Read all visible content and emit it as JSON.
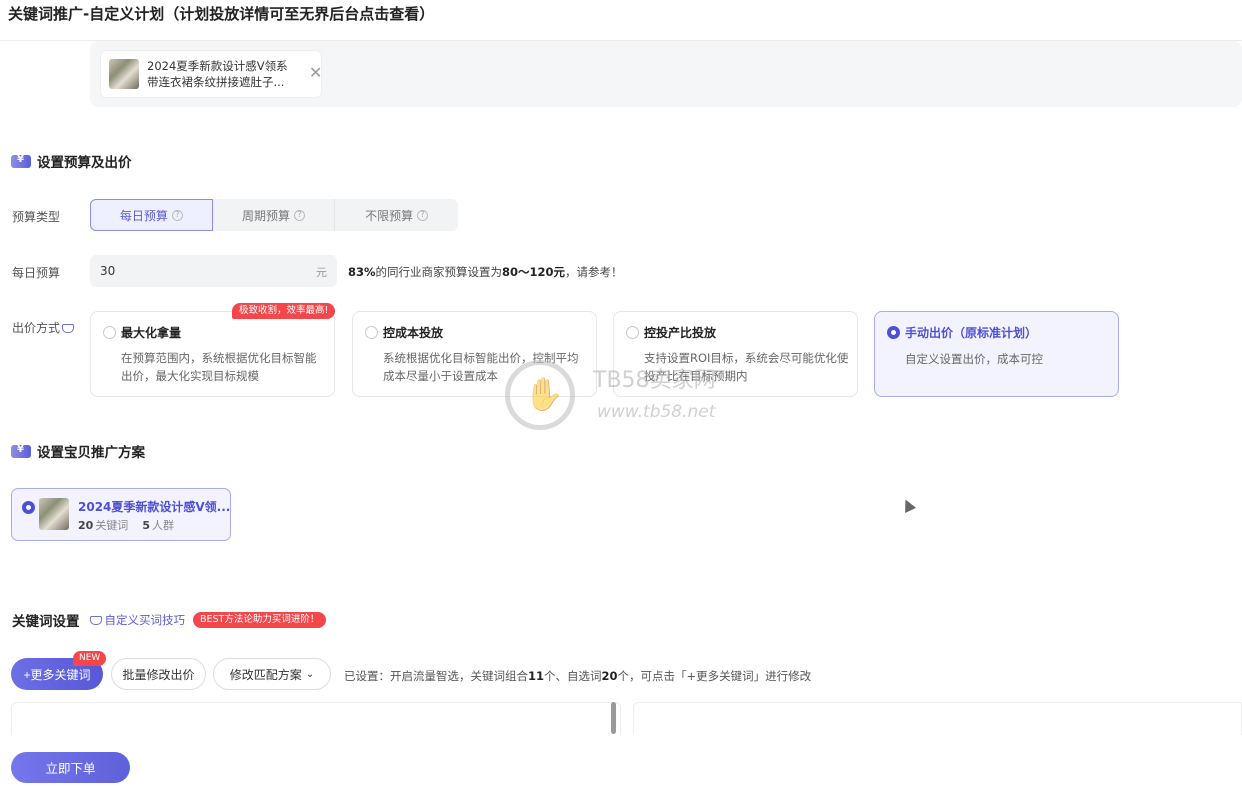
{
  "page": {
    "title": "关键词推广-自定义计划（计划投放详情可至无界后台点击查看）"
  },
  "selected_product": {
    "name": "2024夏季新款设计感V领系带连衣裙条纹拼接遮肚子...",
    "close_glyph": "✕"
  },
  "budget_section": {
    "heading": "设置预算及出价",
    "budget_type_label": "预算类型",
    "budget_types": [
      {
        "label": "每日预算",
        "active": true
      },
      {
        "label": "周期预算",
        "active": false
      },
      {
        "label": "不限预算",
        "active": false
      }
    ],
    "daily_budget_label": "每日预算",
    "daily_budget_value": "30",
    "daily_budget_unit": "元",
    "tip_percent": "83%",
    "tip_mid": "的同行业商家预算设置为",
    "tip_range": "80～120元",
    "tip_end": "，请参考！",
    "bid_method_label": "出价方式",
    "hot_badge": "极致收割，效率最高!",
    "bid_options": [
      {
        "title": "最大化拿量",
        "desc": "在预算范围内，系统根据优化目标智能出价，最大化实现目标规模",
        "active": false
      },
      {
        "title": "控成本投放",
        "desc": "系统根据优化目标智能出价，控制平均成本尽量小于设置成本",
        "active": false
      },
      {
        "title": "控投产比投放",
        "desc": "支持设置ROI目标，系统会尽可能优化使投产比在目标预期内",
        "active": false
      },
      {
        "title": "手动出价（原标准计划）",
        "desc": "自定义设置出价，成本可控",
        "active": true
      }
    ]
  },
  "plan_section": {
    "heading": "设置宝贝推广方案",
    "plan": {
      "name": "2024夏季新款设计感V领...",
      "keyword_count": "20",
      "keyword_label": "关键词",
      "crowd_count": "5",
      "crowd_label": "人群"
    }
  },
  "keyword_section": {
    "heading": "关键词设置",
    "tip_link": "自定义买词技巧",
    "badge": "BEST方法论助力买词进阶！",
    "buttons": {
      "more_keywords": "+更多关键词",
      "new_tag": "NEW",
      "batch_bid": "批量修改出价",
      "match_plan": "修改匹配方案"
    },
    "status_a": "已设置：开启流量智选，关键词组合",
    "status_combo_count": "11",
    "status_b": "个、自选词",
    "status_self_count": "20",
    "status_c": "个，可点击「+更多关键词」进行修改"
  },
  "footer": {
    "submit_label": "立即下单"
  },
  "watermark": {
    "line1": "TB58卖家网",
    "line2": "www.tb58.net"
  },
  "colors": {
    "accent": "#5b5bd6",
    "badge_red": "#f4474c",
    "active_bg": "#f3f3ff"
  }
}
